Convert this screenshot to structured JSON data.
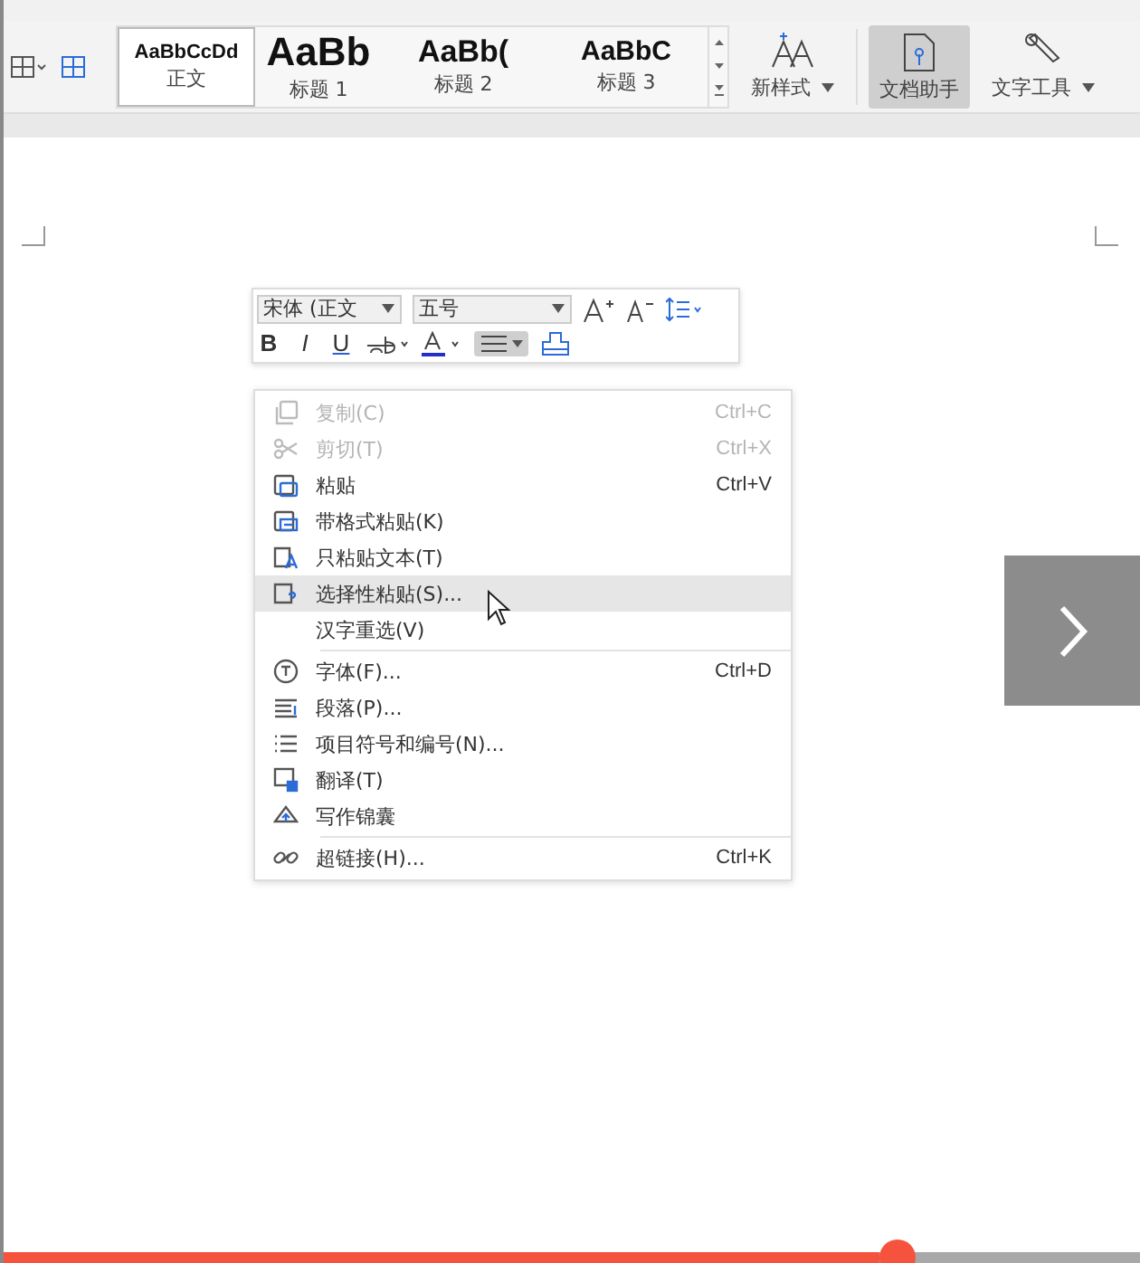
{
  "ribbon": {
    "styles": [
      {
        "preview": "AaBbCcDd",
        "label": "正文",
        "selected": true,
        "kind": "small"
      },
      {
        "preview": "AaBb",
        "label": "标题 1",
        "selected": false,
        "kind": "h1"
      },
      {
        "preview": "AaBb(",
        "label": "标题 2",
        "selected": false,
        "kind": "h2"
      },
      {
        "preview": "AaBbC",
        "label": "标题 3",
        "selected": false,
        "kind": "h3"
      }
    ],
    "new_style": "新样式",
    "doc_assistant": {
      "label": "文档助手",
      "selected": true
    },
    "text_tools": "文字工具"
  },
  "mini_toolbar": {
    "font": "宋体 (正文",
    "size": "五号",
    "bold": "B",
    "italic": "I",
    "underline": "U",
    "align_selected": true
  },
  "context_menu": [
    {
      "kind": "item",
      "label": "复制(C)",
      "shortcut": "Ctrl+C",
      "disabled": true,
      "selected": false
    },
    {
      "kind": "item",
      "label": "剪切(T)",
      "shortcut": "Ctrl+X",
      "disabled": true,
      "selected": false
    },
    {
      "kind": "item",
      "label": "粘贴",
      "shortcut": "Ctrl+V",
      "disabled": false,
      "selected": false
    },
    {
      "kind": "item",
      "label": "带格式粘贴(K)",
      "disabled": false,
      "selected": false
    },
    {
      "kind": "item",
      "label": "只粘贴文本(T)",
      "disabled": false,
      "selected": false
    },
    {
      "kind": "item",
      "label": "选择性粘贴(S)...",
      "disabled": false,
      "selected": true
    },
    {
      "kind": "item",
      "label": "汉字重选(V)",
      "disabled": false,
      "selected": false
    },
    {
      "kind": "separator"
    },
    {
      "kind": "item",
      "label": "字体(F)...",
      "shortcut": "Ctrl+D",
      "disabled": false,
      "selected": false
    },
    {
      "kind": "item",
      "label": "段落(P)...",
      "disabled": false,
      "selected": false
    },
    {
      "kind": "item",
      "label": "项目符号和编号(N)...",
      "disabled": false,
      "selected": false
    },
    {
      "kind": "item",
      "label": "翻译(T)",
      "disabled": false,
      "selected": false
    },
    {
      "kind": "item",
      "label": "写作锦囊",
      "disabled": false,
      "selected": false
    },
    {
      "kind": "separator"
    },
    {
      "kind": "item",
      "label": "超链接(H)...",
      "shortcut": "Ctrl+K",
      "disabled": false,
      "selected": false
    }
  ],
  "video": {
    "level": 0.77
  }
}
